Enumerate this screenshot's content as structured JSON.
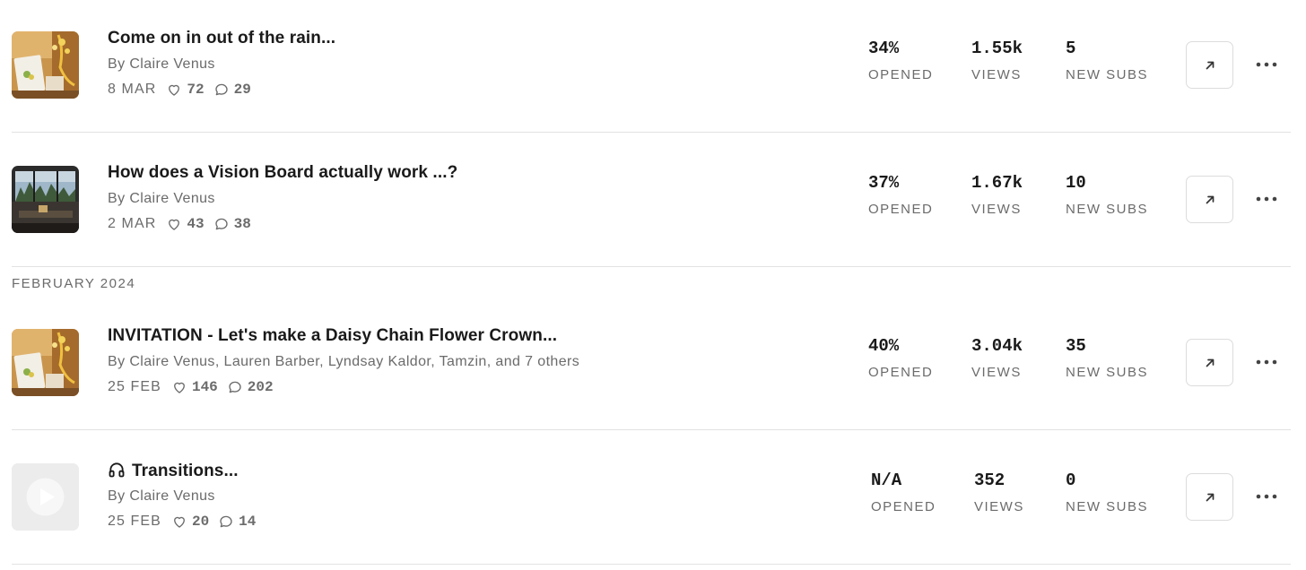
{
  "section_label": "FEBRUARY 2024",
  "posts": [
    {
      "title": "Come on in out of the rain...",
      "authors": "By Claire Venus",
      "date": "8 MAR",
      "likes": "72",
      "comments": "29",
      "opened": "34%",
      "opened_label": "OPENED",
      "views": "1.55k",
      "views_label": "VIEWS",
      "subs": "5",
      "subs_label": "NEW SUBS",
      "thumbnail": "kitchen-flowers"
    },
    {
      "title": "How does a Vision Board actually work ...?",
      "authors": "By Claire Venus",
      "date": "2 MAR",
      "likes": "43",
      "comments": "38",
      "opened": "37%",
      "opened_label": "OPENED",
      "views": "1.67k",
      "views_label": "VIEWS",
      "subs": "10",
      "subs_label": "NEW SUBS",
      "thumbnail": "window-view"
    },
    {
      "title": "INVITATION - Let's make a Daisy Chain Flower Crown...",
      "authors": "By Claire Venus, Lauren Barber, Lyndsay Kaldor, Tamzin, and 7 others",
      "date": "25 FEB",
      "likes": "146",
      "comments": "202",
      "opened": "40%",
      "opened_label": "OPENED",
      "views": "3.04k",
      "views_label": "VIEWS",
      "subs": "35",
      "subs_label": "NEW SUBS",
      "thumbnail": "kitchen-flowers"
    },
    {
      "title": "Transitions...",
      "authors": "By Claire Venus",
      "date": "25 FEB",
      "likes": "20",
      "comments": "14",
      "opened": "N/A",
      "opened_label": "OPENED",
      "views": "352",
      "views_label": "VIEWS",
      "subs": "0",
      "subs_label": "NEW SUBS",
      "thumbnail": "audio-placeholder",
      "title_icon": "headphones-icon"
    }
  ],
  "icons": {
    "like": "heart-icon",
    "comment": "comment-icon",
    "open": "arrow-up-right-icon",
    "more": "ellipsis-icon"
  }
}
